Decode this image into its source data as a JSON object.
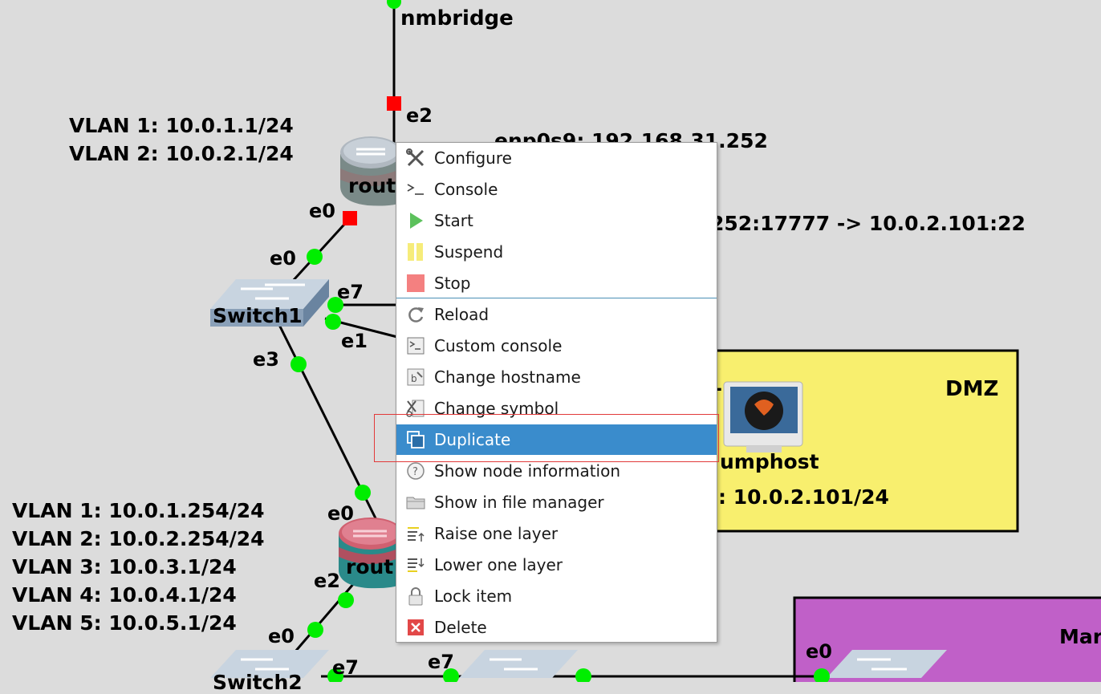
{
  "topology": {
    "nmbridge_label": "nmbridge",
    "router1": {
      "name_partial": "rout",
      "vlan_notes": [
        "VLAN 1: 10.0.1.1/24",
        "VLAN 2: 10.0.2.1/24"
      ],
      "enp_note": "enp0s9: 192.168.31.252",
      "nat_note": "252:17777 -> 10.0.2.101:22",
      "ifaces": {
        "e2": "e2",
        "e0": "e0"
      }
    },
    "switch1": {
      "name": "Switch1",
      "ifaces": {
        "e0": "e0",
        "e7": "e7",
        "e1": "e1",
        "e3": "e3"
      }
    },
    "router2": {
      "name_partial": "rout",
      "vlan_notes": [
        "VLAN 1: 10.0.1.254/24",
        "VLAN 2: 10.0.2.254/24",
        "VLAN 3: 10.0.3.1/24",
        "VLAN 4: 10.0.4.1/24",
        "VLAN 5: 10.0.5.1/24"
      ],
      "ifaces": {
        "e0": "e0",
        "e2": "e2"
      }
    },
    "switch2": {
      "name_partial": "Switch2",
      "ifaces": {
        "e0": "e0",
        "e7": "e7"
      }
    },
    "switch3": {
      "ifaces": {
        "e7": "e7"
      }
    },
    "dmz": {
      "title": "DMZ",
      "host_label": "umphost",
      "host_ip": ": 10.0.2.101/24",
      "partial_char": "L"
    },
    "mgmt": {
      "title_partial": "Mar",
      "iface_e0": "e0"
    }
  },
  "context_menu": {
    "items": [
      {
        "label": "Configure",
        "icon": "wrench-screwdriver-icon"
      },
      {
        "label": "Console",
        "icon": "terminal-prompt-icon"
      },
      {
        "label": "Start",
        "icon": "play-icon"
      },
      {
        "label": "Suspend",
        "icon": "pause-icon"
      },
      {
        "label": "Stop",
        "icon": "stop-icon"
      },
      {
        "label": "Reload",
        "icon": "reload-icon"
      },
      {
        "label": "Custom console",
        "icon": "custom-console-icon"
      },
      {
        "label": "Change hostname",
        "icon": "change-hostname-icon"
      },
      {
        "label": "Change symbol",
        "icon": "change-symbol-icon"
      },
      {
        "label": "Duplicate",
        "icon": "duplicate-icon",
        "active": true
      },
      {
        "label": "Show node information",
        "icon": "info-icon"
      },
      {
        "label": "Show in file manager",
        "icon": "folder-icon"
      },
      {
        "label": "Raise one layer",
        "icon": "raise-layer-icon"
      },
      {
        "label": "Lower one layer",
        "icon": "lower-layer-icon"
      },
      {
        "label": "Lock item",
        "icon": "lock-icon"
      },
      {
        "label": "Delete",
        "icon": "delete-icon"
      }
    ]
  },
  "colors": {
    "canvas_bg": "#dcdcdc",
    "link_up": "#00ee00",
    "link_down": "#ff0000",
    "dmz_zone": "#f8ef6e",
    "mgmt_zone": "#c060c8",
    "menu_active": "#3a8ccc"
  }
}
